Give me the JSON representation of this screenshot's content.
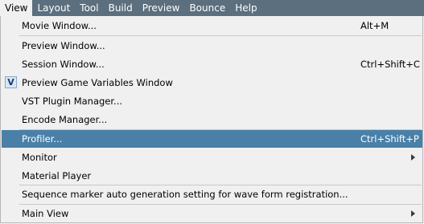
{
  "menubar": {
    "items": [
      {
        "label": "View",
        "active": true
      },
      {
        "label": "Layout"
      },
      {
        "label": "Tool"
      },
      {
        "label": "Build"
      },
      {
        "label": "Preview"
      },
      {
        "label": "Bounce"
      },
      {
        "label": "Help"
      }
    ]
  },
  "colors": {
    "menubar_bg": "#5b6f7e",
    "highlight_bg": "#4a80a8",
    "dropdown_bg": "#f0f0f0"
  },
  "view_menu": {
    "items": [
      {
        "label": "Movie Window...",
        "shortcut": "Alt+M"
      },
      {
        "label": "Preview Window..."
      },
      {
        "label": "Session Window...",
        "shortcut": "Ctrl+Shift+C"
      },
      {
        "label": "Preview Game Variables Window",
        "checked": true,
        "check_glyph": "V"
      },
      {
        "label": "VST Plugin Manager..."
      },
      {
        "label": "Encode Manager..."
      },
      {
        "label": "Profiler...",
        "shortcut": "Ctrl+Shift+P",
        "highlighted": true
      },
      {
        "label": "Monitor",
        "submenu": true
      },
      {
        "label": "Material Player"
      },
      {
        "label": "Sequence marker auto generation setting for wave form registration..."
      },
      {
        "label": "Main View",
        "submenu": true
      }
    ]
  }
}
